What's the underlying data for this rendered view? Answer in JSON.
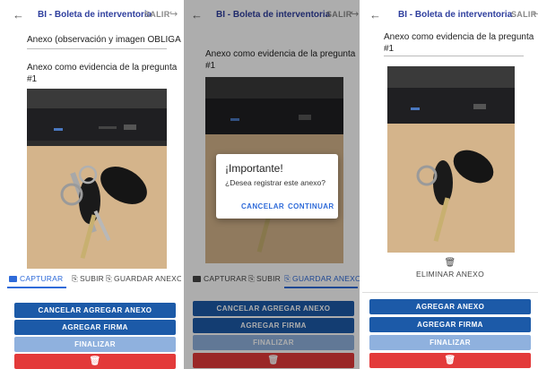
{
  "app": {
    "back_icon": "←",
    "title": "BI - Boleta de interventoria",
    "salir": "SALIR",
    "logout_icon": "→"
  },
  "form": {
    "anexo_field": "Anexo (observación y imagen OBLIGA...",
    "evidence_label": "Anexo como evidencia de la pregunta #1",
    "evidence_line1": "Anexo como evidencia de la pregunta",
    "evidence_line2": "#1",
    "anexo_field_full_line1": "Anexo como evidencia de la pregunta",
    "anexo_field_full_line2": "#1"
  },
  "tabs": {
    "capturar": "CAPTURAR",
    "subir": "SUBIR",
    "guardar": "GUARDAR ANEXO"
  },
  "buttons": {
    "cancelar_agregar": "CANCELAR AGREGAR ANEXO",
    "agregar_anexo": "AGREGAR ANEXO",
    "agregar_firma": "AGREGAR FIRMA",
    "finalizar": "FINALIZAR",
    "eliminar_anexo": "ELIMINAR ANEXO",
    "trash_icon": "🗑"
  },
  "dialog": {
    "title": "¡Importante!",
    "message": "¿Desea registrar este anexo?",
    "cancel": "CANCELAR",
    "continue": "CONTINUAR"
  },
  "colors": {
    "primary": "#1c5aa8",
    "accent": "#2f6bd9",
    "title": "#2f3f9e",
    "danger": "#e33a3a"
  }
}
